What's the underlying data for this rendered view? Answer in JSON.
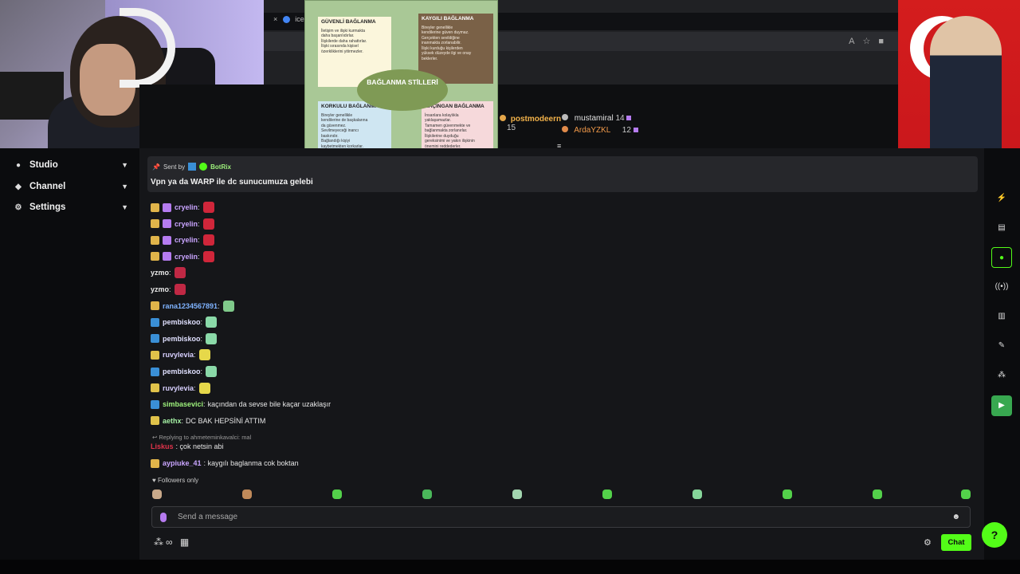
{
  "browser": {
    "tab_label": "ice",
    "close_glyph": "×"
  },
  "poster": {
    "center_title": "BAĞLANMA STİLLERİ",
    "box1": {
      "heading": "GÜVENLİ BAĞLANMA",
      "lines": [
        "İletişim ve ilişki kurmakta",
        "daha başarılıdırlar.",
        "İlişkilerde daha rahattırlar.",
        "İlişki sırasında kişisel",
        "özerkliklerini yitirmezler."
      ]
    },
    "box2": {
      "heading": "KAYGILI BAĞLANMA",
      "lines": [
        "Bireyler genellikle",
        "kendilerine güven duymaz.",
        "Gerçekten sevildiğine",
        "inanmakta zorlanabilir.",
        "İlişki kurduğu kişilerden",
        "yüksek düzeyde ilgi ve onay",
        "beklerler."
      ]
    },
    "box3": {
      "heading": "KORKULU BAĞLANMA",
      "lines": [
        "Bireyler genellikle",
        "kendilerine de başkalarına",
        "da güvenmez.",
        "Sevilmeyeceği inancı",
        "baskındır.",
        "Bağlandığı kişiyi",
        "kaybetmekten korkarlar."
      ]
    },
    "box4": {
      "heading": "KAÇINGAN BAĞLANMA",
      "lines": [
        "İnsanlara kolaylıkla",
        "yaklaşamazlar.",
        "Tamamen güvenmekte ve",
        "bağlanmakta zorlanırlar.",
        "İlişkilerine duyduğu",
        "gereksinimi ve yakın ilişkinin",
        "önemini reddederler."
      ]
    }
  },
  "leaderboard": [
    {
      "name": "postmodeern",
      "count": "15"
    },
    {
      "name": "mustamiral",
      "count": "14"
    },
    {
      "name": "ArdaYZKL",
      "count": "12"
    }
  ],
  "sidebar": {
    "items": [
      {
        "label": "Studio",
        "icon": "studio-icon"
      },
      {
        "label": "Channel",
        "icon": "channel-icon"
      },
      {
        "label": "Settings",
        "icon": "gear-icon"
      }
    ]
  },
  "pinned": {
    "sent_by": "Sent by",
    "bot_name": "BotRix",
    "message": "Vpn ya da WARP ile dc sunucumuza gelebi"
  },
  "messages": [
    {
      "user": "cryelin",
      "text": "",
      "color": "#c9a5ff"
    },
    {
      "user": "cryelin",
      "text": "",
      "color": "#c9a5ff"
    },
    {
      "user": "cryelin",
      "text": "",
      "color": "#c9a5ff"
    },
    {
      "user": "cryelin",
      "text": "",
      "color": "#c9a5ff"
    },
    {
      "user": "yzmo",
      "text": "",
      "color": "#e8e8e8"
    },
    {
      "user": "yzmo",
      "text": "",
      "color": "#e8e8e8"
    },
    {
      "user": "rana1234567891",
      "text": "",
      "color": "#7fb3ff"
    },
    {
      "user": "pembiskoo",
      "text": "",
      "color": "#e0e0ff"
    },
    {
      "user": "pembiskoo",
      "text": "",
      "color": "#e0e0ff"
    },
    {
      "user": "ruvylevia",
      "text": "",
      "color": "#d8d0ff"
    },
    {
      "user": "pembiskoo",
      "text": "",
      "color": "#e0e0ff"
    },
    {
      "user": "ruvylevia",
      "text": "",
      "color": "#d8d0ff"
    },
    {
      "user": "simbasevici",
      "text": "kaçından da sevse bile kaçar uzaklaşır",
      "color": "#9ef27c"
    },
    {
      "user": "aethx",
      "text": "DC BAK HEPSİNİ ATTIM",
      "color": "#a4f0a4"
    }
  ],
  "reply": {
    "label": "Replying to ahmeteminkavalci: mal",
    "user": "Liskus",
    "text": "çok netsin abi"
  },
  "last_message": {
    "user": "aypiuke_41",
    "text": "kaygılı baglanma cok boktan"
  },
  "followers_only": "Followers only",
  "input": {
    "placeholder": "Send a message"
  },
  "chat_button": "Chat",
  "colors": {
    "accent": "#53fc18",
    "bg": "#151619"
  }
}
